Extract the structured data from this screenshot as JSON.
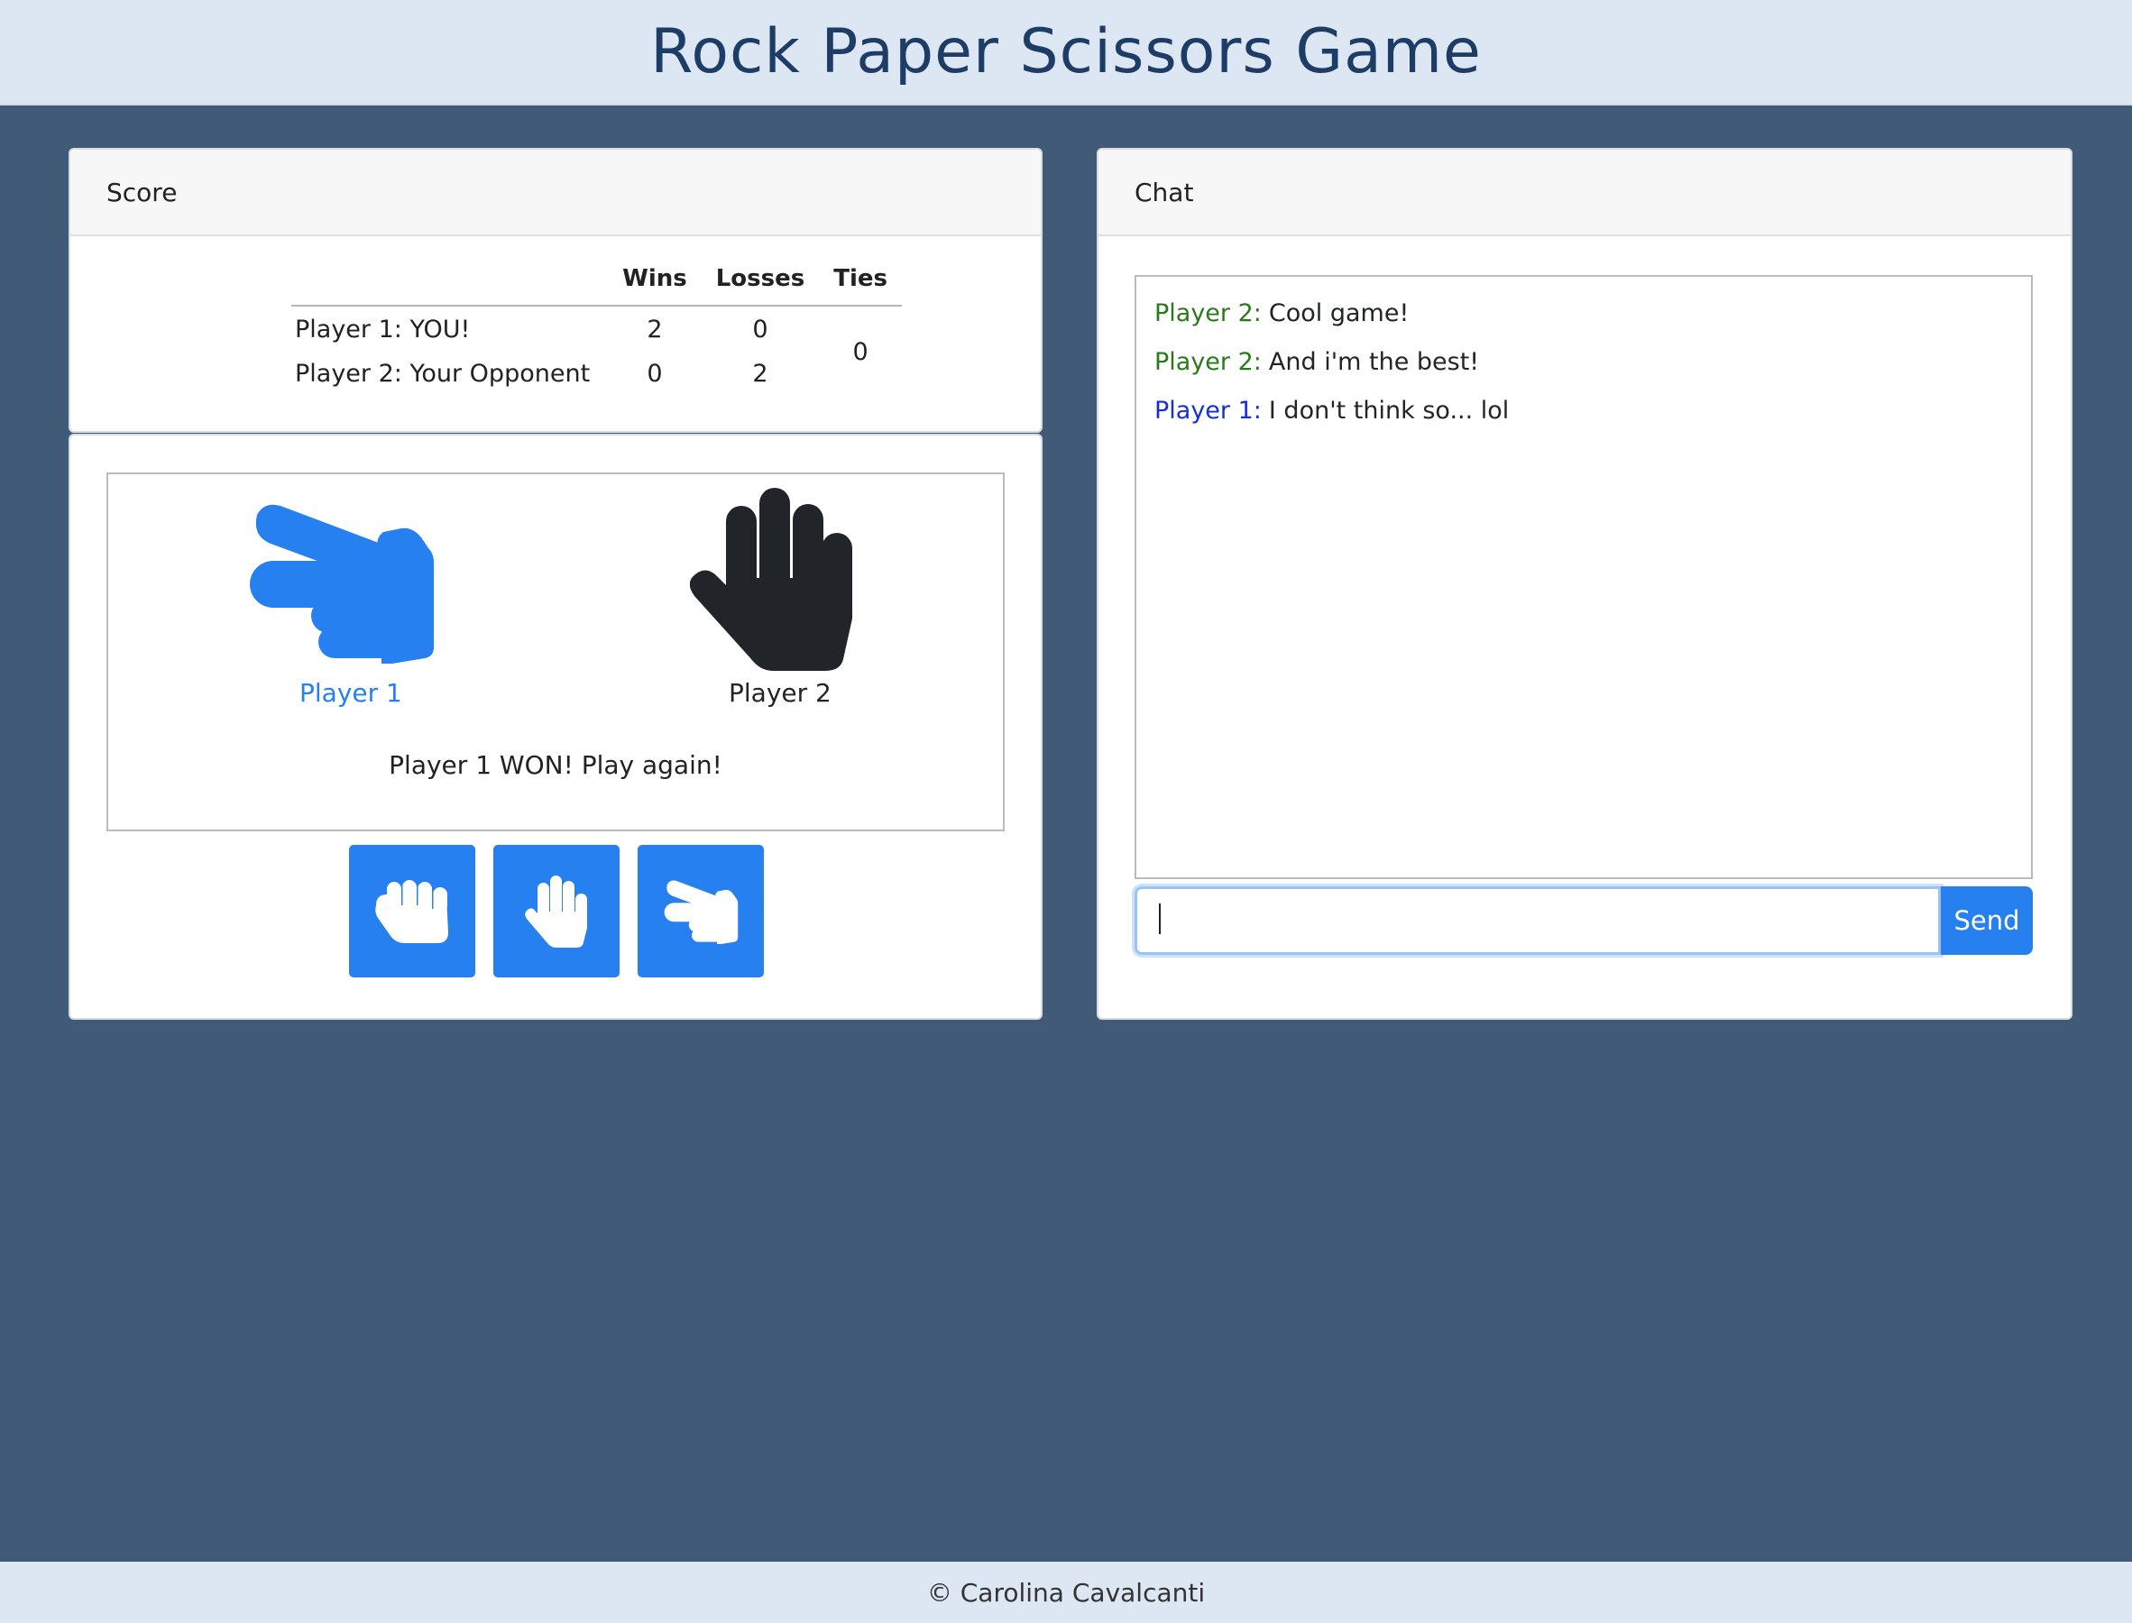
{
  "page": {
    "title": "Rock Paper Scissors Game",
    "footer": "© Carolina Cavalcanti"
  },
  "score": {
    "header": "Score",
    "columns": [
      "Wins",
      "Losses",
      "Ties"
    ],
    "rows": [
      {
        "name": "Player 1: YOU!",
        "wins": "2",
        "losses": "0"
      },
      {
        "name": "Player 2: Your Opponent",
        "wins": "0",
        "losses": "2"
      }
    ],
    "ties": "0"
  },
  "game": {
    "player1": {
      "label": "Player 1",
      "choice": "scissors-icon",
      "color": "#2780f0"
    },
    "player2": {
      "label": "Player 2",
      "choice": "paper-icon",
      "color": "#212529"
    },
    "result": "Player 1 WON! Play again!",
    "choices": [
      "rock-icon",
      "paper-icon",
      "scissors-icon"
    ],
    "button_color": "#2780f0"
  },
  "chat": {
    "header": "Chat",
    "messages": [
      {
        "sender": "Player 2:",
        "text": "Cool game!",
        "color": "#2a7a1c"
      },
      {
        "sender": "Player 2:",
        "text": "And i'm the best!",
        "color": "#2a7a1c"
      },
      {
        "sender": "Player 1:",
        "text": "I don't think so... lol",
        "color": "#1530d8"
      }
    ],
    "input_value": "",
    "send_label": "Send"
  },
  "colors": {
    "background": "#415a78",
    "header_bg": "#dde7f3",
    "title": "#1e3d66",
    "accent": "#2780f0"
  }
}
